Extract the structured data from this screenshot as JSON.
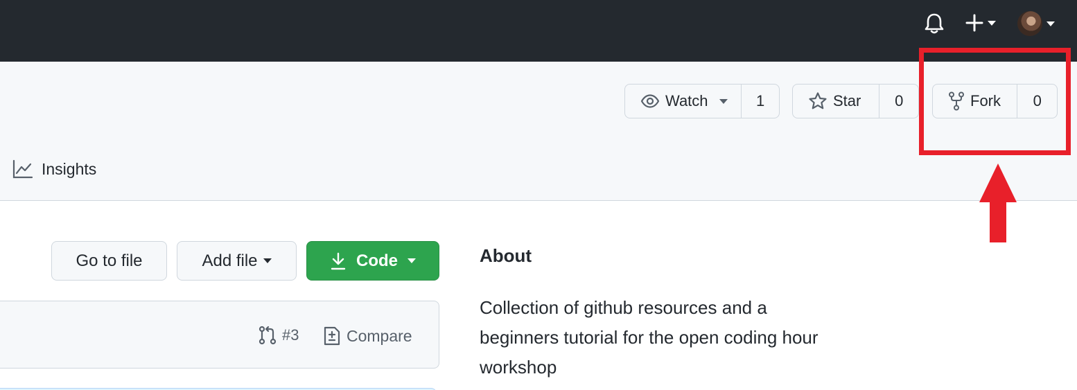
{
  "topbar": {
    "bell_icon": "bell-icon",
    "plus_icon": "plus-icon",
    "avatar": "user-avatar"
  },
  "repo_actions": {
    "watch": {
      "label": "Watch",
      "count": "1",
      "icon": "eye-icon"
    },
    "star": {
      "label": "Star",
      "count": "0",
      "icon": "star-icon"
    },
    "fork": {
      "label": "Fork",
      "count": "0",
      "icon": "repo-forked-icon"
    }
  },
  "nav": {
    "insights": {
      "label": "Insights",
      "icon": "graph-icon"
    }
  },
  "file_actions": {
    "go_to_file": "Go to file",
    "add_file": "Add file",
    "code": "Code"
  },
  "branch_bar": {
    "pull_requests": "#3",
    "compare": "Compare"
  },
  "about": {
    "title": "About",
    "description": "Collection of github resources and a beginners tutorial for the open coding hour workshop"
  },
  "colors": {
    "topbar": "#24292f",
    "code_button": "#2da44e",
    "highlight": "#e8202a"
  }
}
